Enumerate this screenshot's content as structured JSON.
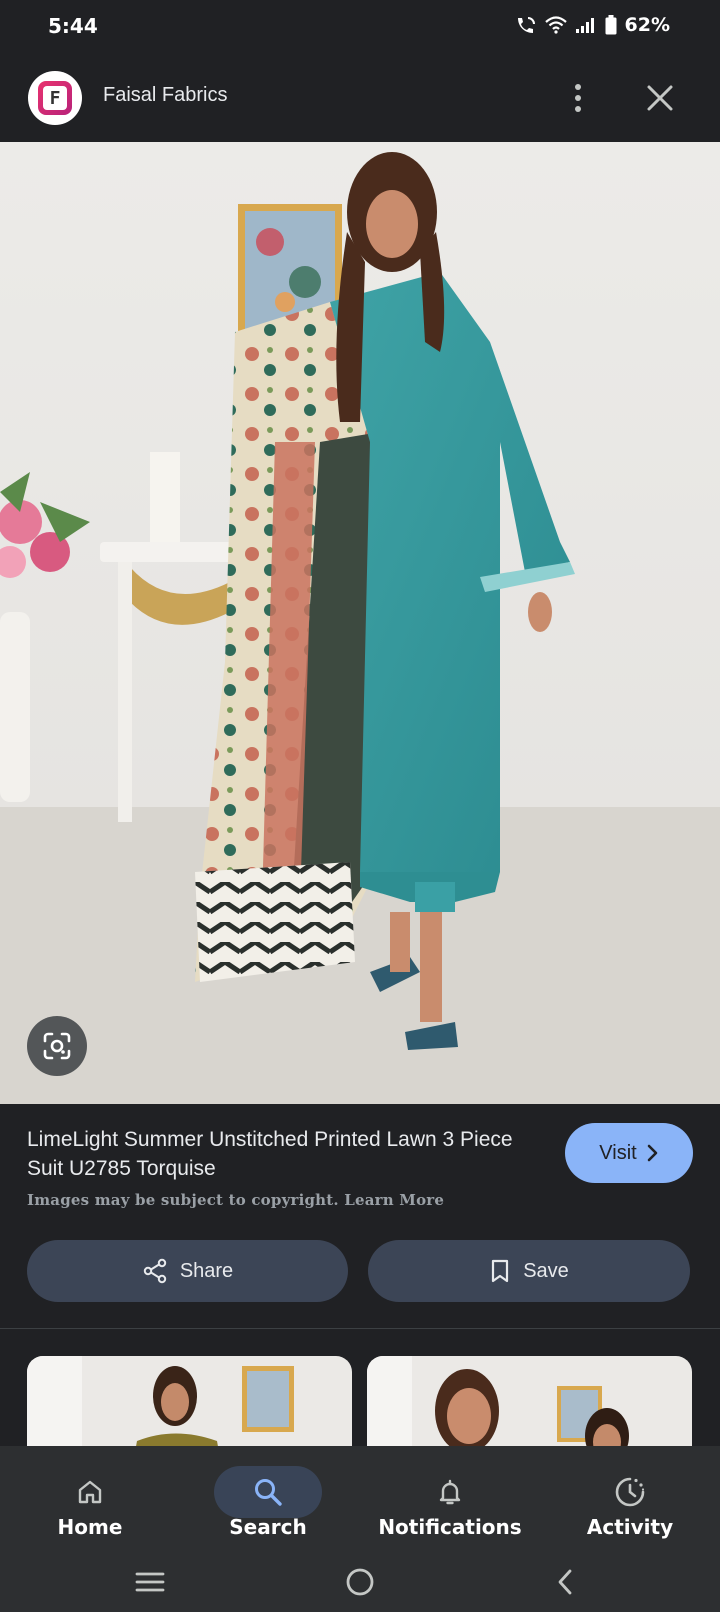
{
  "status_bar": {
    "time": "5:44",
    "battery": "62%"
  },
  "header": {
    "site_name": "Faisal Fabrics",
    "logo_letter": "F"
  },
  "result": {
    "title": "LimeLight Summer Unstitched Printed Lawn 3 Piece Suit U2785 Torquise",
    "copyright_note": "Images may be subject to copyright. Learn More",
    "visit_label": "Visit"
  },
  "actions": {
    "share_label": "Share",
    "save_label": "Save"
  },
  "bottom_nav": {
    "items": [
      {
        "label": "Home",
        "icon": "home-icon",
        "active": false
      },
      {
        "label": "Search",
        "icon": "search-icon",
        "active": true
      },
      {
        "label": "Notifications",
        "icon": "bell-icon",
        "active": false
      },
      {
        "label": "Activity",
        "icon": "activity-icon",
        "active": false
      }
    ]
  },
  "colors": {
    "background": "#202124",
    "accent": "#8ab4f8",
    "button": "#3c4556",
    "nav": "#2d2f31"
  }
}
